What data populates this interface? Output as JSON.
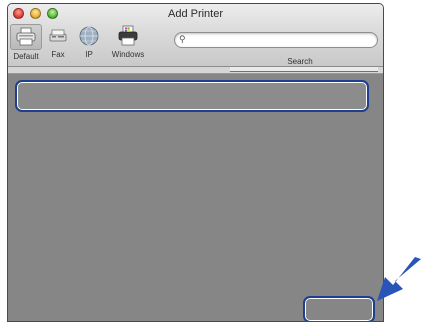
{
  "window": {
    "title": "Add Printer"
  },
  "toolbar": {
    "items": [
      {
        "label": "Default",
        "icon": "default-printer-icon"
      },
      {
        "label": "Fax",
        "icon": "fax-icon"
      },
      {
        "label": "IP",
        "icon": "ip-globe-icon"
      },
      {
        "label": "Windows",
        "icon": "windows-printer-icon"
      }
    ],
    "search": {
      "label": "Search",
      "value": ""
    }
  },
  "annotation": {
    "highlight_color": "#1c3f8f",
    "arrow_color": "#2a55b8"
  }
}
